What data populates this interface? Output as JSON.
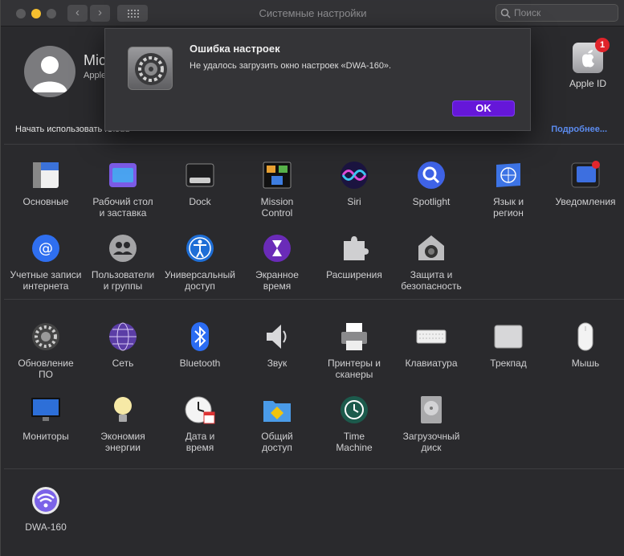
{
  "window": {
    "title": "Системные настройки"
  },
  "toolbar": {
    "back": "‹",
    "forward": "›"
  },
  "search": {
    "placeholder": "Поиск"
  },
  "user": {
    "name": "Mic",
    "subtitle": "Apple",
    "apple_id_label": "Apple ID",
    "badge_count": "1"
  },
  "banner": {
    "start_text": "Начать использовать iCloud",
    "more_link": "Подробнее..."
  },
  "dialog": {
    "title": "Ошибка настроек",
    "message": "Не удалось загрузить окно настроек «DWA-160».",
    "ok_label": "OK"
  },
  "sections": {
    "personal": [
      {
        "label": "Основные",
        "icon": "general-icon"
      },
      {
        "label": "Рабочий стол\nи заставка",
        "icon": "desktop-icon"
      },
      {
        "label": "Dock",
        "icon": "dock-icon"
      },
      {
        "label": "Mission\nControl",
        "icon": "mission-control-icon"
      },
      {
        "label": "Siri",
        "icon": "siri-icon"
      },
      {
        "label": "Spotlight",
        "icon": "spotlight-icon"
      },
      {
        "label": "Язык и\nрегион",
        "icon": "language-icon"
      },
      {
        "label": "Уведомления",
        "icon": "notifications-icon"
      },
      {
        "label": "Учетные записи\nинтернета",
        "icon": "internet-accounts-icon"
      },
      {
        "label": "Пользователи\nи группы",
        "icon": "users-icon"
      },
      {
        "label": "Универсальный\nдоступ",
        "icon": "accessibility-icon"
      },
      {
        "label": "Экранное\nвремя",
        "icon": "screen-time-icon"
      },
      {
        "label": "Расширения",
        "icon": "extensions-icon"
      },
      {
        "label": "Защита и\nбезопасность",
        "icon": "security-icon"
      }
    ],
    "hardware": [
      {
        "label": "Обновление\nПО",
        "icon": "software-update-icon"
      },
      {
        "label": "Сеть",
        "icon": "network-icon"
      },
      {
        "label": "Bluetooth",
        "icon": "bluetooth-icon"
      },
      {
        "label": "Звук",
        "icon": "sound-icon"
      },
      {
        "label": "Принтеры и\nсканеры",
        "icon": "printer-icon"
      },
      {
        "label": "Клавиатура",
        "icon": "keyboard-icon"
      },
      {
        "label": "Трекпад",
        "icon": "trackpad-icon"
      },
      {
        "label": "Мышь",
        "icon": "mouse-icon"
      },
      {
        "label": "Мониторы",
        "icon": "displays-icon"
      },
      {
        "label": "Экономия\nэнергии",
        "icon": "energy-icon"
      },
      {
        "label": "Дата и\nвремя",
        "icon": "date-time-icon"
      },
      {
        "label": "Общий\nдоступ",
        "icon": "sharing-icon"
      },
      {
        "label": "Time\nMachine",
        "icon": "time-machine-icon"
      },
      {
        "label": "Загрузочный\nдиск",
        "icon": "startup-disk-icon"
      }
    ],
    "other": [
      {
        "label": "DWA-160",
        "icon": "wifi-icon"
      }
    ]
  },
  "colors": {
    "accent": "#6517d9",
    "link": "#5c8cf0",
    "badge": "#e0232a"
  }
}
